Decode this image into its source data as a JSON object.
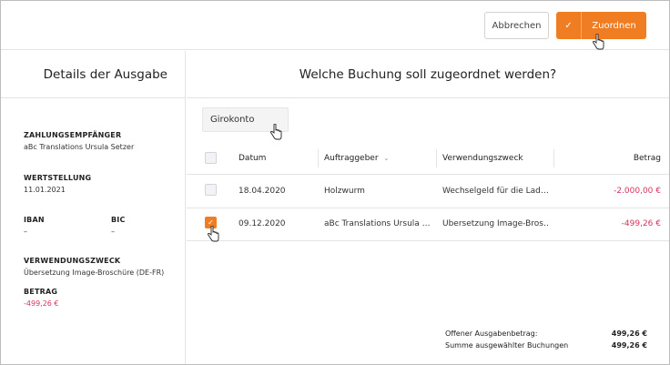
{
  "toolbar": {
    "cancel_label": "Abbrechen",
    "assign_label": "Zuordnen"
  },
  "left": {
    "title": "Details der Ausgabe",
    "payee_label": "ZAHLUNGSEMPFÄNGER",
    "payee_value": "aBc Translations Ursula Setzer",
    "valuedate_label": "WERTSTELLUNG",
    "valuedate_value": "11.01.2021",
    "iban_label": "IBAN",
    "iban_value": "–",
    "bic_label": "BIC",
    "bic_value": "–",
    "purpose_label": "VERWENDUNGSZWECK",
    "purpose_value": "Übersetzung Image-Broschüre (DE-FR)",
    "amount_label": "BETRAG",
    "amount_value": "-499,26 €"
  },
  "main": {
    "title": "Welche Buchung soll zugeordnet werden?",
    "account": "Girokonto",
    "headers": {
      "date": "Datum",
      "payer": "Auftraggeber",
      "purpose": "Verwendungszweck",
      "amount": "Betrag"
    },
    "rows": [
      {
        "date": "18.04.2020",
        "payer": "Holzwurm",
        "purpose": "Wechselgeld für die Lad…",
        "amount": "-2.000,00 €",
        "checked": false
      },
      {
        "date": "09.12.2020",
        "payer": "aBc Translations Ursula …",
        "purpose": "Übersetzung Image-Bros…",
        "amount": "-499,26 €",
        "checked": true
      }
    ],
    "summary": {
      "open_label": "Offener Ausgabenbetrag:",
      "open_value": "499,26 €",
      "selected_label": "Summe ausgewählter Buchungen",
      "selected_value": "499,26 €"
    }
  },
  "colors": {
    "accent": "#f07d22",
    "negative": "#d9345b"
  }
}
